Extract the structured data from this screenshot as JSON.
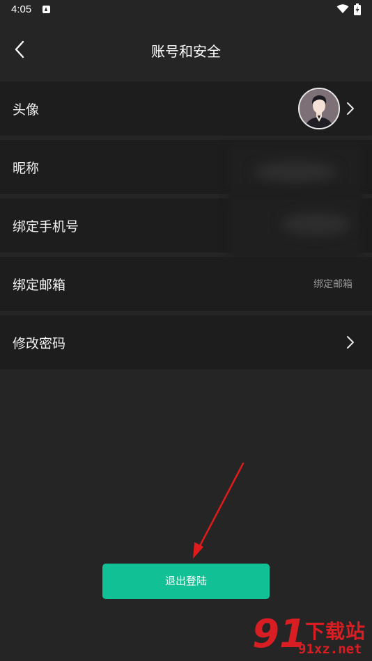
{
  "status_bar": {
    "time": "4:05"
  },
  "header": {
    "title": "账号和安全"
  },
  "rows": [
    {
      "label": "头像"
    },
    {
      "label": "昵称"
    },
    {
      "label": "绑定手机号"
    },
    {
      "label": "绑定邮箱",
      "value": "绑定邮箱"
    },
    {
      "label": "修改密码"
    }
  ],
  "logout": {
    "label": "退出登陆"
  },
  "watermark": {
    "brand": "91",
    "name": "下载站",
    "url": "91xz.net"
  },
  "colors": {
    "background": "#252525",
    "row": "#1d1d1d",
    "accent": "#12c095",
    "annotation": "#e01b1b"
  }
}
